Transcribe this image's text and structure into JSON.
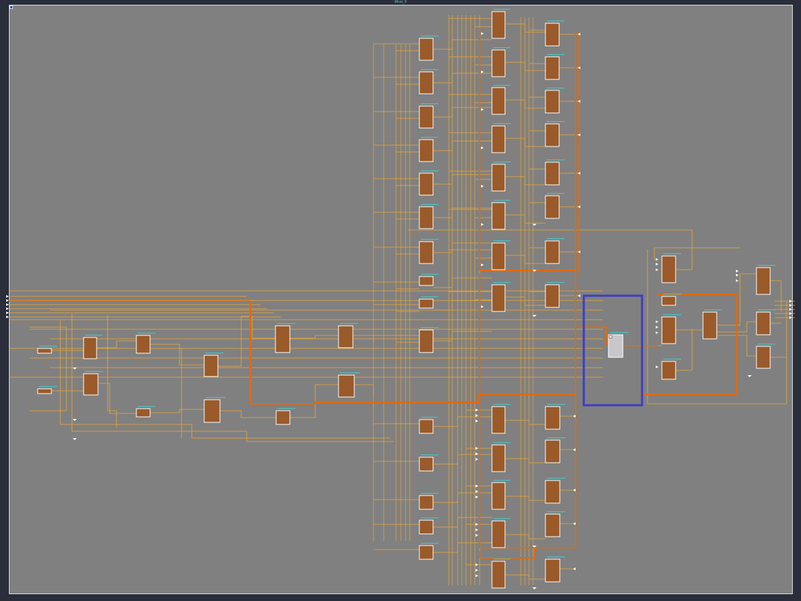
{
  "window": {
    "title": "dbuo_0"
  },
  "colors": {
    "background": "#2a2d3a",
    "canvas": "#808080",
    "wire": "#f0a830",
    "bus": "#e06a10",
    "cell_fill": "#9a5a2a",
    "cell_border": "#ffffff",
    "label": "#3fd3d3",
    "selection": "#3c3cc8",
    "selected_cell": "#c8c8cc"
  },
  "icons": {
    "collapse": "collapse-icon"
  }
}
